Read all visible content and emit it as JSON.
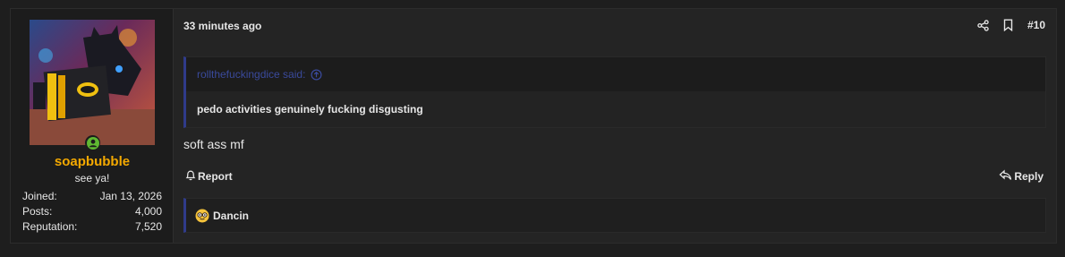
{
  "post": {
    "number": "#10",
    "timestamp": "33 minutes ago",
    "message": "soft ass mf"
  },
  "user": {
    "name": "soapbubble",
    "title": "see ya!",
    "name_color": "#f4a900",
    "online_color": "#5fb832",
    "avatar_icon": "avatar-image",
    "stats": [
      {
        "label": "Joined:",
        "value": "Jan 13, 2026"
      },
      {
        "label": "Posts:",
        "value": "4,000"
      },
      {
        "label": "Reputation:",
        "value": "7,520"
      }
    ]
  },
  "quote": {
    "author": "rollthefuckingdice said:",
    "text": "pedo activities genuinely fucking disgusting",
    "accent": "#2f3b8a"
  },
  "actions": {
    "report_label": "Report",
    "reply_label": "Reply"
  },
  "reactions": {
    "user": "Dancin",
    "emoji_icon": "nerd-face-emoji"
  }
}
